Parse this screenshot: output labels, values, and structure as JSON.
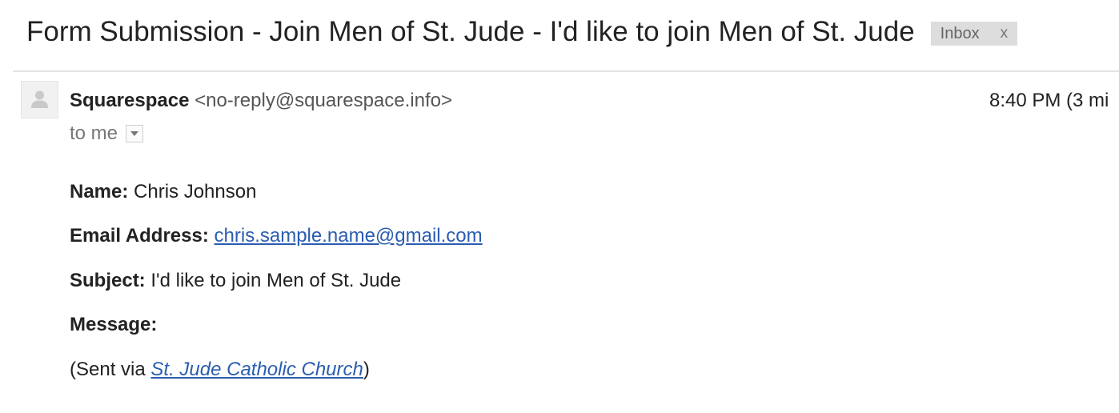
{
  "email": {
    "subject": "Form Submission - Join Men of St. Jude - I'd like to join Men of St. Jude",
    "label": {
      "text": "Inbox",
      "remove": "x"
    },
    "sender": {
      "name": "Squarespace",
      "address": "<no-reply@squarespace.info>"
    },
    "timestamp": "8:40 PM (3 mi",
    "recipient": "to me",
    "body": {
      "name_label": "Name:",
      "name_value": "Chris Johnson",
      "email_label": "Email Address:",
      "email_value": "chris.sample.name@gmail.com",
      "subject_label": "Subject:",
      "subject_value": "I'd like to join Men of St. Jude",
      "message_label": "Message:",
      "sent_via_prefix": "(Sent via ",
      "sent_via_link": "St. Jude Catholic Church",
      "sent_via_suffix": ")"
    }
  },
  "colors": {
    "link": "#2a5db0",
    "label_chip_bg": "#dddddd",
    "divider": "#e3e3e3"
  },
  "icons": {
    "avatar": "default-person-icon",
    "details_toggle": "dropdown-arrow-icon"
  }
}
